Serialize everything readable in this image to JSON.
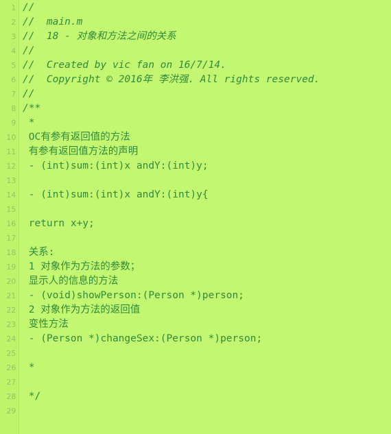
{
  "editor": {
    "background_color": "#c4f771",
    "gutter_color": "#bdf46a",
    "gutter_border_color": "#a9e95c",
    "line_number_color": "#8fc46a",
    "comment_color": "#2e8b3a",
    "code_color": "#176b26",
    "total_visible_lines": 29,
    "file_name": "main.m"
  },
  "lines": [
    {
      "num": "1",
      "text": "//",
      "style": "comment"
    },
    {
      "num": "2",
      "text": "//  main.m",
      "style": "comment"
    },
    {
      "num": "3",
      "text": "//  18 - 对象和方法之间的关系",
      "style": "comment"
    },
    {
      "num": "4",
      "text": "//",
      "style": "comment"
    },
    {
      "num": "5",
      "text": "//  Created by vic fan on 16/7/14.",
      "style": "comment"
    },
    {
      "num": "6",
      "text": "//  Copyright © 2016年 李洪强. All rights reserved.",
      "style": "comment"
    },
    {
      "num": "7",
      "text": "//",
      "style": "comment"
    },
    {
      "num": "8",
      "text": "/**",
      "style": "comment"
    },
    {
      "num": "9",
      "text": " *",
      "style": "doc"
    },
    {
      "num": "10",
      "text": " OC有参有返回值的方法",
      "style": "doc"
    },
    {
      "num": "11",
      "text": " 有参有返回值方法的声明",
      "style": "doc"
    },
    {
      "num": "12",
      "text": " - (int)sum:(int)x andY:(int)y;",
      "style": "doc"
    },
    {
      "num": "13",
      "text": "",
      "style": "doc"
    },
    {
      "num": "14",
      "text": " - (int)sum:(int)x andY:(int)y{",
      "style": "doc"
    },
    {
      "num": "15",
      "text": "",
      "style": "doc"
    },
    {
      "num": "16",
      "text": " return x+y;",
      "style": "doc"
    },
    {
      "num": "17",
      "text": "",
      "style": "doc"
    },
    {
      "num": "18",
      "text": " 关系:",
      "style": "doc"
    },
    {
      "num": "19",
      "text": " 1 对象作为方法的参数；",
      "style": "doc"
    },
    {
      "num": "20",
      "text": " 显示人的信息的方法",
      "style": "doc"
    },
    {
      "num": "21",
      "text": " - (void)showPerson:(Person *)person;",
      "style": "doc"
    },
    {
      "num": "22",
      "text": " 2 对象作为方法的返回值",
      "style": "doc"
    },
    {
      "num": "23",
      "text": " 变性方法",
      "style": "doc"
    },
    {
      "num": "24",
      "text": " - (Person *)changeSex:(Person *)person;",
      "style": "doc"
    },
    {
      "num": "25",
      "text": "",
      "style": "doc"
    },
    {
      "num": "26",
      "text": " *",
      "style": "doc"
    },
    {
      "num": "27",
      "text": "",
      "style": "doc"
    },
    {
      "num": "28",
      "text": " */",
      "style": "doc"
    },
    {
      "num": "29",
      "text": "",
      "style": "doc"
    }
  ]
}
